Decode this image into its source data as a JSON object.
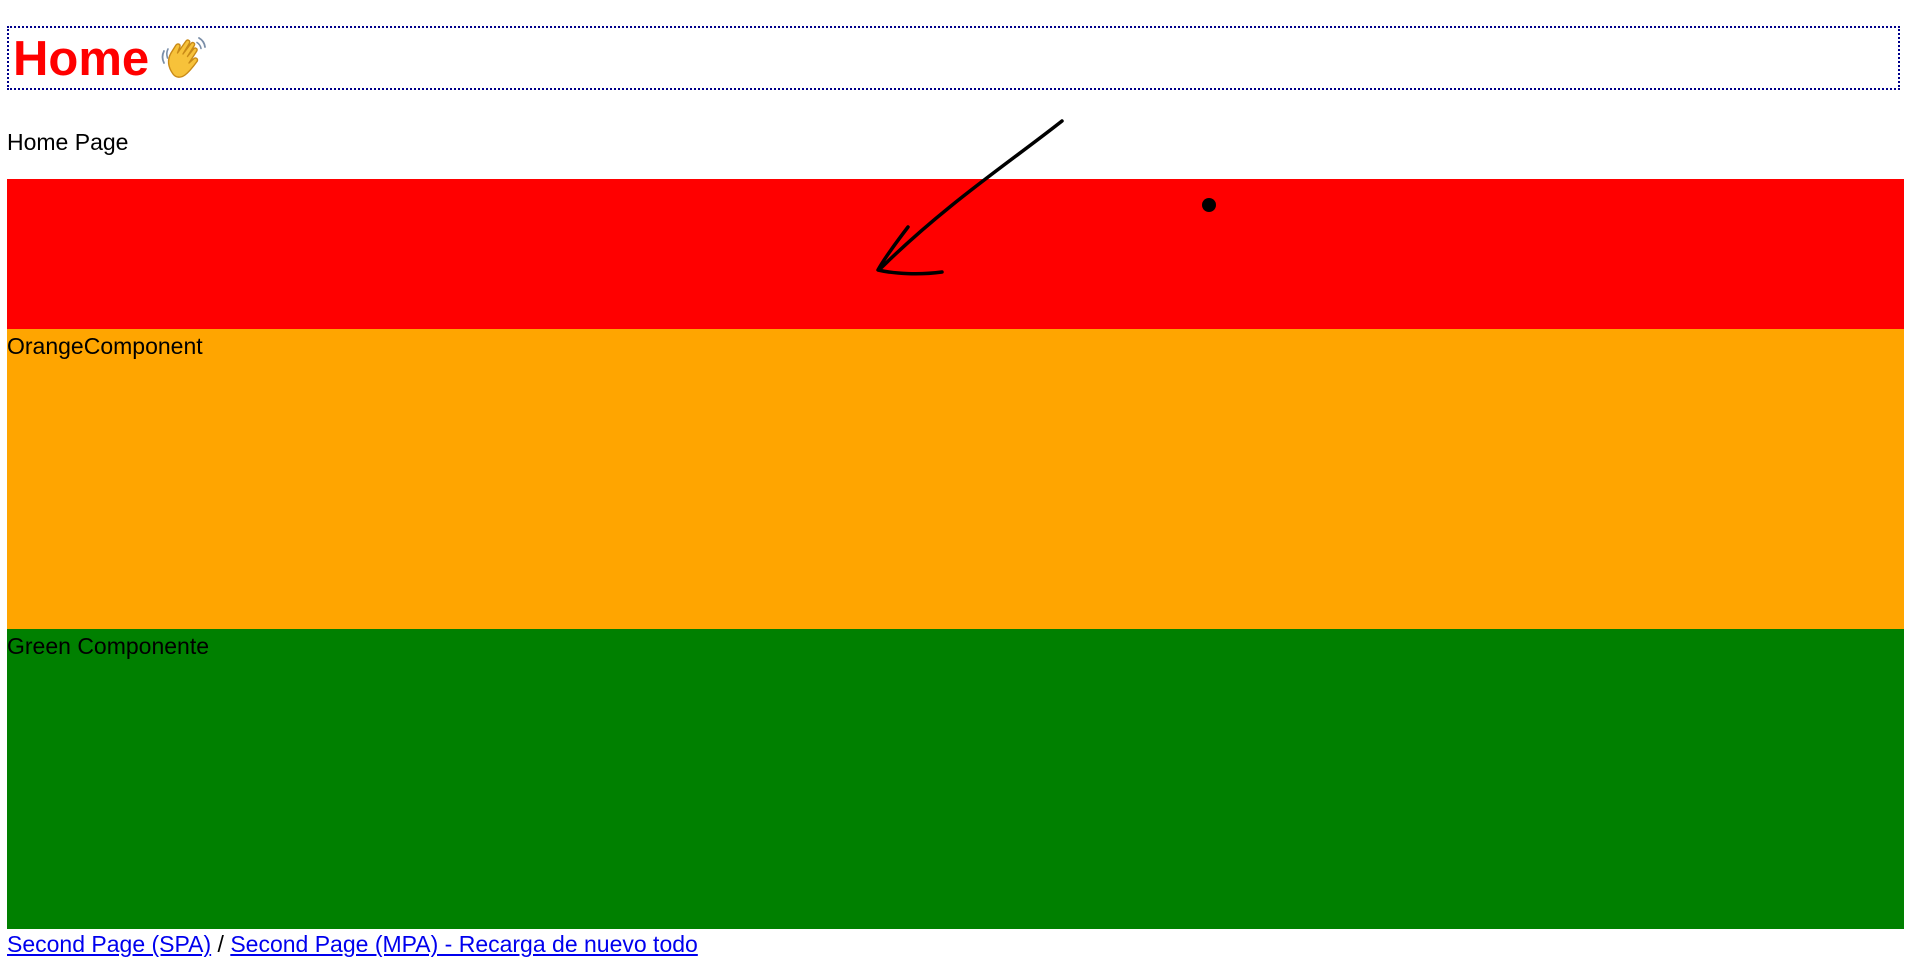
{
  "header": {
    "title": "Home",
    "icon": "waving-hand-icon"
  },
  "page": {
    "subtitle": "Home Page"
  },
  "sections": {
    "red": {
      "color": "#ff0000"
    },
    "orange": {
      "label": "OrangeComponent",
      "color": "#ffa500"
    },
    "green": {
      "label": "Green Componente",
      "color": "#008000"
    }
  },
  "nav": {
    "spa_link": "Second Page (SPA)",
    "separator": "/",
    "mpa_link": "Second Page (MPA) - Recarga de nuevo todo",
    "link_color": "#0000ee"
  },
  "colors": {
    "title": "#ff0000",
    "title_border": "#00008b"
  }
}
